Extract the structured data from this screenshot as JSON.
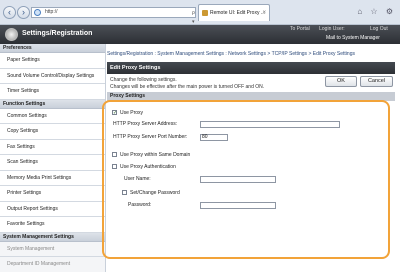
{
  "browser": {
    "url": "http://",
    "tab_title": "Remote UI: Edit Proxy ...",
    "back_glyph": "‹",
    "forward_glyph": "›",
    "tab_close_glyph": "×",
    "addr_tools": "ρ ▾ ⊠ C ×",
    "right_icons": "⌂ ☆ ⚙"
  },
  "header": {
    "title": "Settings/Registration",
    "to_portal": "To Portal",
    "login_user": "Login User:",
    "logout": "Log Out",
    "mail": "Mail to System Manager"
  },
  "sidebar": {
    "preferences_heading": "Preferences",
    "preferences_items": [
      "Paper Settings",
      "Sound Volume Control/Display Settings",
      "Timer Settings"
    ],
    "function_heading": "Function Settings",
    "function_items": [
      "Common Settings",
      "Copy Settings",
      "Fax Settings",
      "Scan Settings",
      "Memory Media Print Settings",
      "Printer Settings",
      "Output Report Settings",
      "Favorite Settings"
    ],
    "system_heading": "System Management Settings",
    "system_items": [
      "System Management",
      "Department ID Management"
    ]
  },
  "main": {
    "breadcrumb": "Settings/Registration : System Management Settings : Network Settings > TCP/IP Settings > Edit Proxy Settings",
    "page_title": "Edit Proxy Settings",
    "desc_line1": "Change the following settings.",
    "desc_line2": "Changes will be effective after the main power is turned OFF and ON.",
    "ok_label": "OK",
    "cancel_label": "Cancel",
    "section_title": "Proxy Settings",
    "use_proxy_label": "Use Proxy",
    "use_proxy_checked": true,
    "check_glyph": "✓",
    "http_address_label": "HTTP Proxy Server Address:",
    "http_address_value": "",
    "http_port_label": "HTTP Proxy Server Port Number:",
    "http_port_value": "80",
    "same_domain_label": "Use Proxy within Same Domain",
    "use_auth_label": "Use Proxy Authentication",
    "user_name_label": "User Name:",
    "user_name_value": "",
    "set_change_password_label": "Set/Change Password",
    "password_label": "Password:",
    "password_value": "",
    "highlight_color": "#f2a339"
  }
}
